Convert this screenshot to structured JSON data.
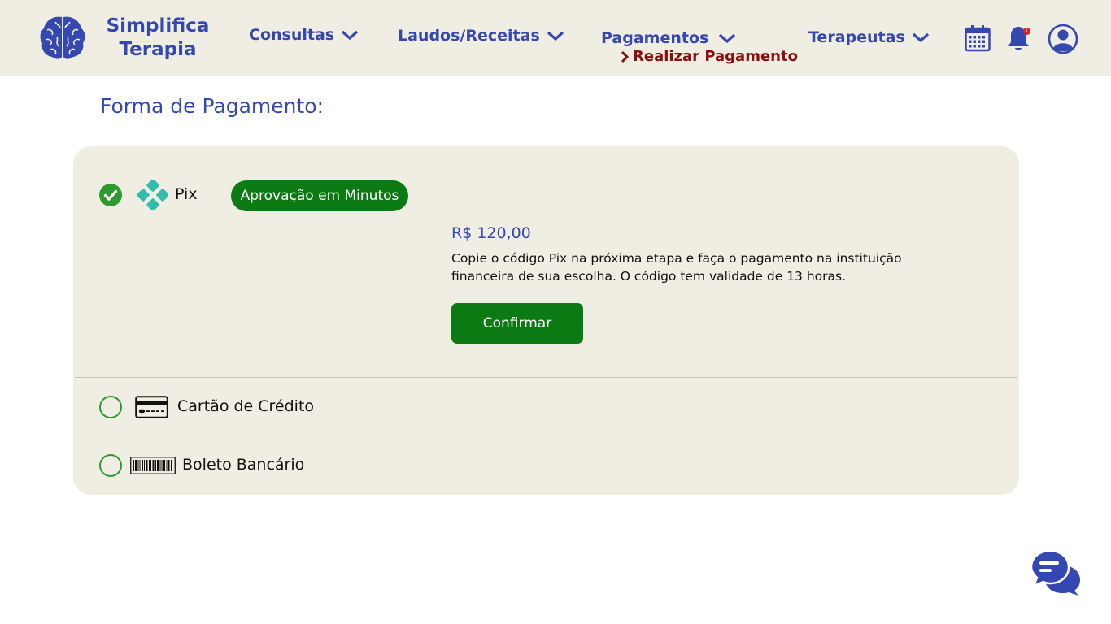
{
  "brand": {
    "line1": "Simplifica",
    "line2": "Terapia"
  },
  "nav": {
    "consultas": "Consultas",
    "laudos": "Laudos/Receitas",
    "pagamentos": "Pagamentos",
    "pagamentos_sub": "Realizar Pagamento",
    "terapeutas": "Terapeutas"
  },
  "header_icons": {
    "calendar": "calendar-icon",
    "notifications": "bell-icon",
    "notification_count": "1",
    "profile": "user-profile-icon"
  },
  "page": {
    "title": "Forma de Pagamento:"
  },
  "payment_methods": [
    {
      "label": "Pix",
      "icon": "pix-icon",
      "selected": true
    },
    {
      "label": "Cartão de Crédito",
      "icon": "credit-card-icon",
      "selected": false
    },
    {
      "label": "Boleto Bancário",
      "icon": "barcode-icon",
      "selected": false
    }
  ],
  "pix": {
    "badge": "Aprovação em Minutos",
    "price": "R$ 120,00",
    "description": "Copie o código Pix na próxima etapa e faça o pagamento na instituição financeira de sua escolha. O código tem validade de 13 horas.",
    "confirm_label": "Confirmar"
  },
  "colors": {
    "brand_blue": "#3548b0",
    "header_bg": "#f0ede2",
    "green": "#0c7a12",
    "radio_green": "#2f9a2f",
    "sub_red": "#8b0e0e"
  },
  "chat": {
    "icon": "chat-bubbles-icon"
  }
}
